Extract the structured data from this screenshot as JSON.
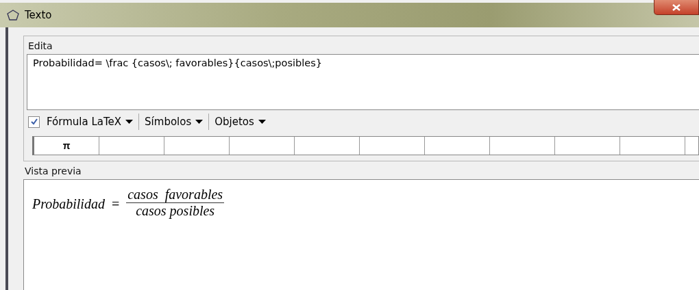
{
  "window": {
    "title": "Texto"
  },
  "edit": {
    "label": "Edita",
    "value": "Probabilidad= \\frac {casos\\; favorables}{casos\\;posibles}"
  },
  "toolbar": {
    "latex": {
      "label": "Fórmula LaTeX",
      "checked": true
    },
    "menus": [
      "Símbolos",
      "Objetos"
    ]
  },
  "symbols": [
    "π"
  ],
  "preview": {
    "label": "Vista previa",
    "lhs": "Probabilidad",
    "equals": "=",
    "numerator": "casos  favorables",
    "denominator": "casos posibles"
  }
}
